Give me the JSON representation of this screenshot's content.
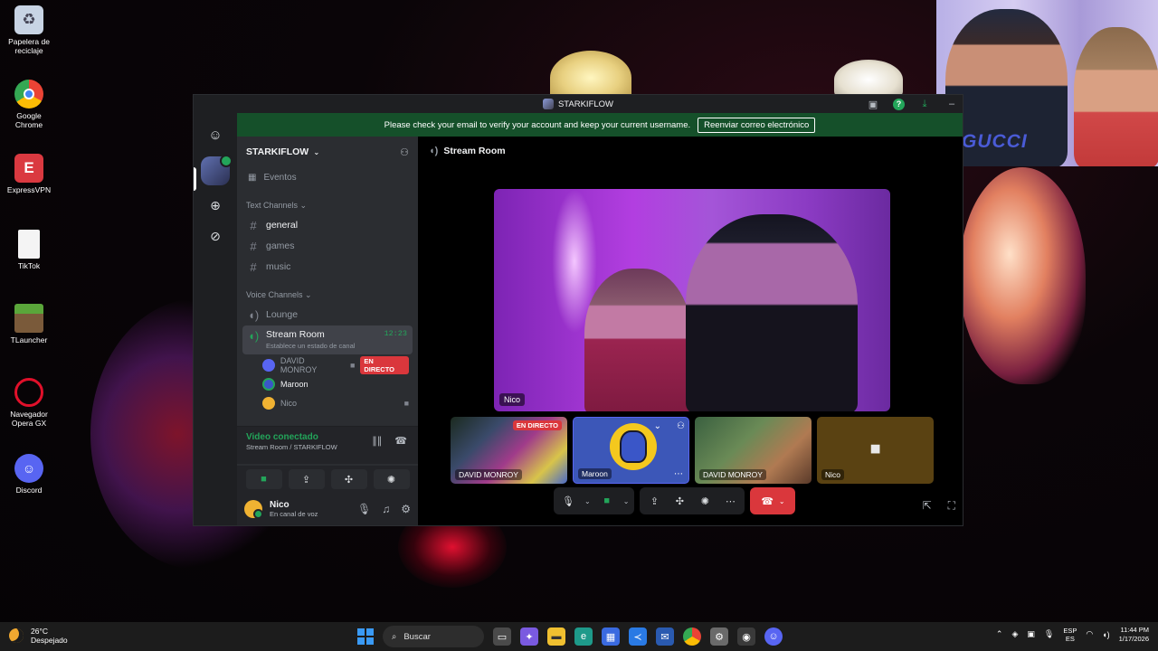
{
  "desktop": {
    "icons": [
      {
        "label": "Papelera de reciclaje",
        "icon": "recycle-bin-icon"
      },
      {
        "label": "Google Chrome",
        "icon": "chrome-icon"
      },
      {
        "label": "ExpressVPN",
        "icon": "expressvpn-icon"
      },
      {
        "label": "TikTok",
        "icon": "file-icon"
      },
      {
        "label": "TLauncher",
        "icon": "minecraft-icon"
      },
      {
        "label": "Navegador Opera GX",
        "icon": "opera-gx-icon"
      },
      {
        "label": "Discord",
        "icon": "discord-icon"
      }
    ]
  },
  "webcam": {
    "shirt_text": "GUCCI"
  },
  "window": {
    "title": "STARKIFLOW",
    "banner_text": "Please check your email to verify your account and keep your current username.",
    "banner_button": "Reenviar correo electrónico"
  },
  "sidebar": {
    "server_name": "STARKIFLOW",
    "events_label": "Eventos",
    "text_category": "Text Channels",
    "text_channels": [
      "general",
      "games",
      "music"
    ],
    "voice_category": "Voice Channels",
    "voice_channels": [
      {
        "name": "Lounge"
      },
      {
        "name": "Stream Room",
        "timer": "12:23",
        "status": "Establece un estado de canal"
      }
    ],
    "members": [
      {
        "name": "DAVID MONROY",
        "badge": "EN DIRECTO"
      },
      {
        "name": "Maroon"
      },
      {
        "name": "Nico"
      }
    ]
  },
  "voice_panel": {
    "title": "Video conectado",
    "subtitle": "Stream Room / STARKIFLOW"
  },
  "user_panel": {
    "name": "Nico",
    "status": "En canal de voz"
  },
  "main": {
    "channel_title": "Stream Room",
    "stage_name": "Nico",
    "tiles": [
      {
        "label": "DAVID MONROY",
        "badge": "EN DIRECTO"
      },
      {
        "label": "Maroon"
      },
      {
        "label": "DAVID MONROY"
      },
      {
        "label": "Nico"
      }
    ]
  },
  "taskbar": {
    "temperature": "26°C",
    "condition": "Despejado",
    "search_placeholder": "Buscar",
    "lang_top": "ESP",
    "lang_bottom": "ES",
    "time": "11:44 PM",
    "date": "1/17/2026"
  },
  "colors": {
    "accent_green": "#23a55a",
    "live_red": "#da373c",
    "blurple": "#5865f2"
  }
}
